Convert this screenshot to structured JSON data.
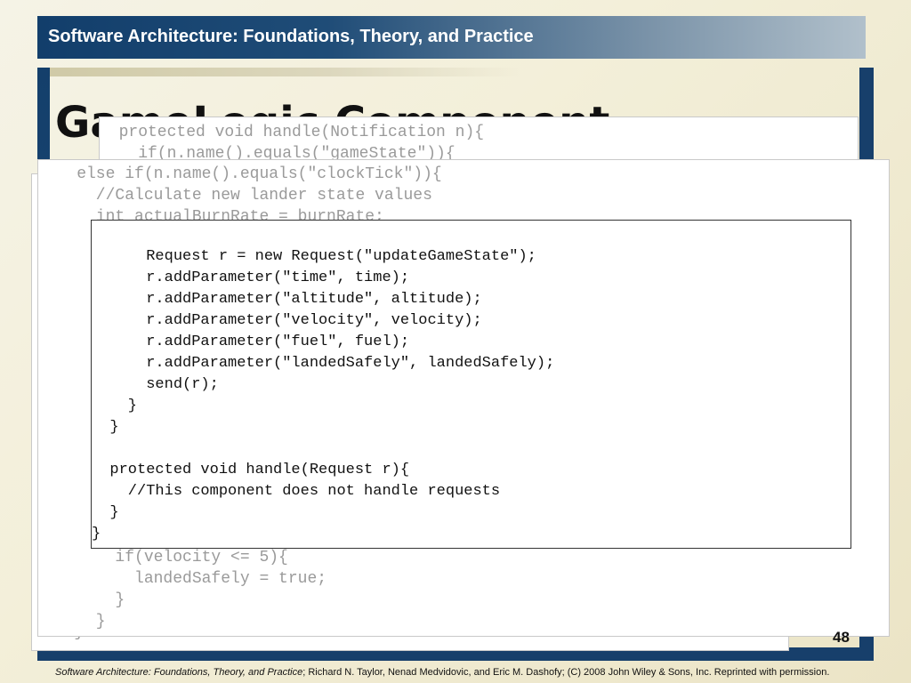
{
  "header": {
    "title": "Software Architecture: Foundations, Theory, and Practice"
  },
  "slide": {
    "title": "GameLogic Component",
    "page_number": "48"
  },
  "back_panels": {
    "panel_a": [
      "  protected void handle(Notification n){",
      "    if(n.name().equals(\"gameState\")){"
    ],
    "panel_c": [
      "    else if(n.name().equals(\"clockTick\")){",
      "      //Calculate new lander state values",
      "      int actualBurnRate = burnRate;"
    ],
    "panel_c_bottom": [
      "        if(velocity <= 5){",
      "          landedSafely = true;",
      "        }",
      "      }"
    ],
    "panel_b_bottom": "    }"
  },
  "code_box": {
    "lines": [
      "",
      "      Request r = new Request(\"updateGameState\");",
      "      r.addParameter(\"time\", time);",
      "      r.addParameter(\"altitude\", altitude);",
      "      r.addParameter(\"velocity\", velocity);",
      "      r.addParameter(\"fuel\", fuel);",
      "      r.addParameter(\"landedSafely\", landedSafely);",
      "      send(r);",
      "    }",
      "  }",
      "",
      "  protected void handle(Request r){",
      "    //This component does not handle requests",
      "  }",
      "}"
    ]
  },
  "footer": {
    "book_title": "Software Architecture: Foundations, Theory, and Practice",
    "rest": "; Richard N. Taylor, Nenad Medvidovic, and Eric M. Dashofy; (C) 2008 John Wiley & Sons, Inc. Reprinted with permission."
  }
}
